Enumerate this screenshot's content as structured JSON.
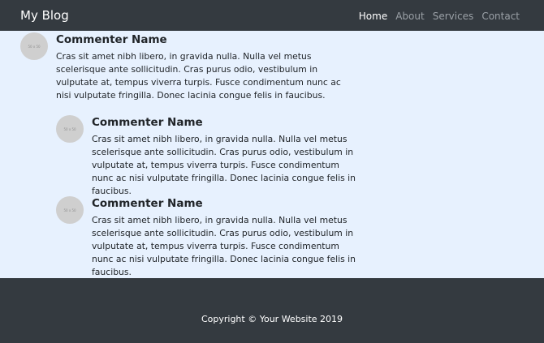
{
  "navbar": {
    "brand": "My Blog",
    "links": [
      {
        "label": "Home",
        "active": true
      },
      {
        "label": "About",
        "active": false
      },
      {
        "label": "Services",
        "active": false
      },
      {
        "label": "Contact",
        "active": false
      }
    ]
  },
  "comments": [
    {
      "avatar_text": "50 x 50",
      "name": "Commenter Name",
      "text": "Cras sit amet nibh libero, in gravida nulla. Nulla vel metus scelerisque ante sollicitudin. Cras purus odio, vestibulum in vulputate at, tempus viverra turpis. Fusce condimentum nunc ac nisi vulputate fringilla. Donec lacinia congue felis in faucibus."
    },
    {
      "avatar_text": "50 x 50",
      "name": "Commenter Name",
      "text": "Cras sit amet nibh libero, in gravida nulla. Nulla vel metus scelerisque ante sollicitudin. Cras purus odio, vestibulum in vulputate at, tempus viverra turpis. Fusce condimentum nunc ac nisi vulputate fringilla. Donec lacinia congue felis in faucibus."
    },
    {
      "avatar_text": "50 x 50",
      "name": "Commenter Name",
      "text": "Cras sit amet nibh libero, in gravida nulla. Nulla vel metus scelerisque ante sollicitudin. Cras purus odio, vestibulum in vulputate at, tempus viverra turpis. Fusce condimentum nunc ac nisi vulputate fringilla. Donec lacinia congue felis in faucibus."
    }
  ],
  "footer": {
    "copyright": "Copyright © Your Website 2019"
  },
  "colors": {
    "navbar_bg": "#343a40",
    "page_bg": "#e7f1fe",
    "avatar_bg": "#cfcfcf"
  }
}
